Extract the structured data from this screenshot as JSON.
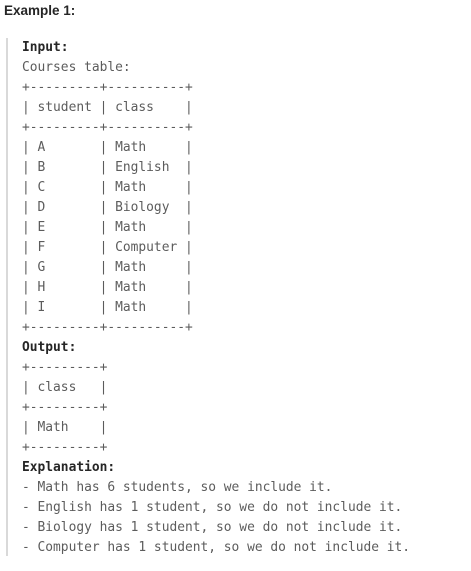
{
  "heading": "Example 1:",
  "input_label": "Input:",
  "input_lines": [
    "Courses table:",
    "+---------+----------+",
    "| student | class    |",
    "+---------+----------+",
    "| A       | Math     |",
    "| B       | English  |",
    "| C       | Math     |",
    "| D       | Biology  |",
    "| E       | Math     |",
    "| F       | Computer |",
    "| G       | Math     |",
    "| H       | Math     |",
    "| I       | Math     |",
    "+---------+----------+"
  ],
  "output_label": "Output:",
  "output_lines": [
    "+---------+",
    "| class   |",
    "+---------+",
    "| Math    |",
    "+---------+"
  ],
  "explanation_label": "Explanation:",
  "explanation_lines": [
    "- Math has 6 students, so we include it.",
    "- English has 1 student, so we do not include it.",
    "- Biology has 1 student, so we do not include it.",
    "- Computer has 1 student, so we do not include it."
  ]
}
